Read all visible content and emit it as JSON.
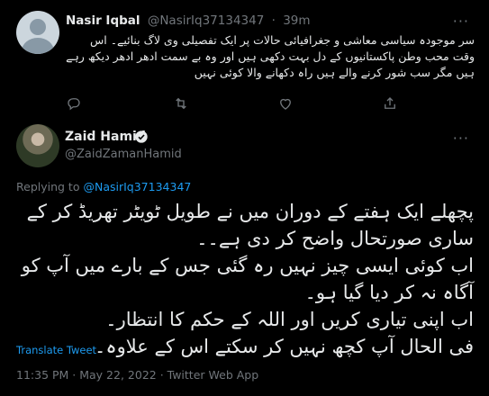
{
  "reply": {
    "name": "Nasir Iqbal",
    "handle": "@NasirIq37134347",
    "separator": "·",
    "time": "39m",
    "text": "سر موجودہ سیاسی معاشی و جغرافیائی حالات پر ایک تفصیلی وی لاگ بنائیے۔ اس وقت محب وطن پاکستانیوں کے دل بہت دکھی ہیں اور وہ بے سمت ادھر ادھر دیکھ رہے ہیں مگر سب شور کرنے والے ہیں راہ دکھانے والا کوئی نہیں",
    "more_icon": "···",
    "actions": [
      {
        "name": "reply",
        "icon": "reply-icon"
      },
      {
        "name": "retweet",
        "icon": "retweet-icon"
      },
      {
        "name": "like",
        "icon": "heart-icon"
      },
      {
        "name": "share",
        "icon": "share-icon"
      }
    ]
  },
  "tweet": {
    "name": "Zaid Hamid",
    "handle": "@ZaidZamanHamid",
    "verified": true,
    "replying_prefix": "Replying to",
    "replying_to": "@NasirIq37134347",
    "text_lines": [
      "پچھلے ایک ہفتے کے دوران میں نے طویل ٹویٹر تھریڈ کر کے",
      "ساری صورتحال واضح کر دی ہے۔۔",
      "اب کوئی ایسی چیز نہیں رہ گئی جس کے بارے میں آپ کو",
      "آگاہ نہ کر دیا گیا ہو۔",
      "اب اپنی تیاری کریں اور اللہ کے حکم کا انتظار۔",
      "فی الحال آپ کچھ نہیں کر سکتے اس کے علاوہ۔"
    ],
    "translate_label": "Translate Tweet",
    "timestamp": "11:35 PM · May 22, 2022 · Twitter Web App",
    "more_icon": "···"
  },
  "colors": {
    "background": "#000000",
    "text": "#e7e9ea",
    "muted": "#71767b",
    "accent": "#1d9bf0"
  }
}
